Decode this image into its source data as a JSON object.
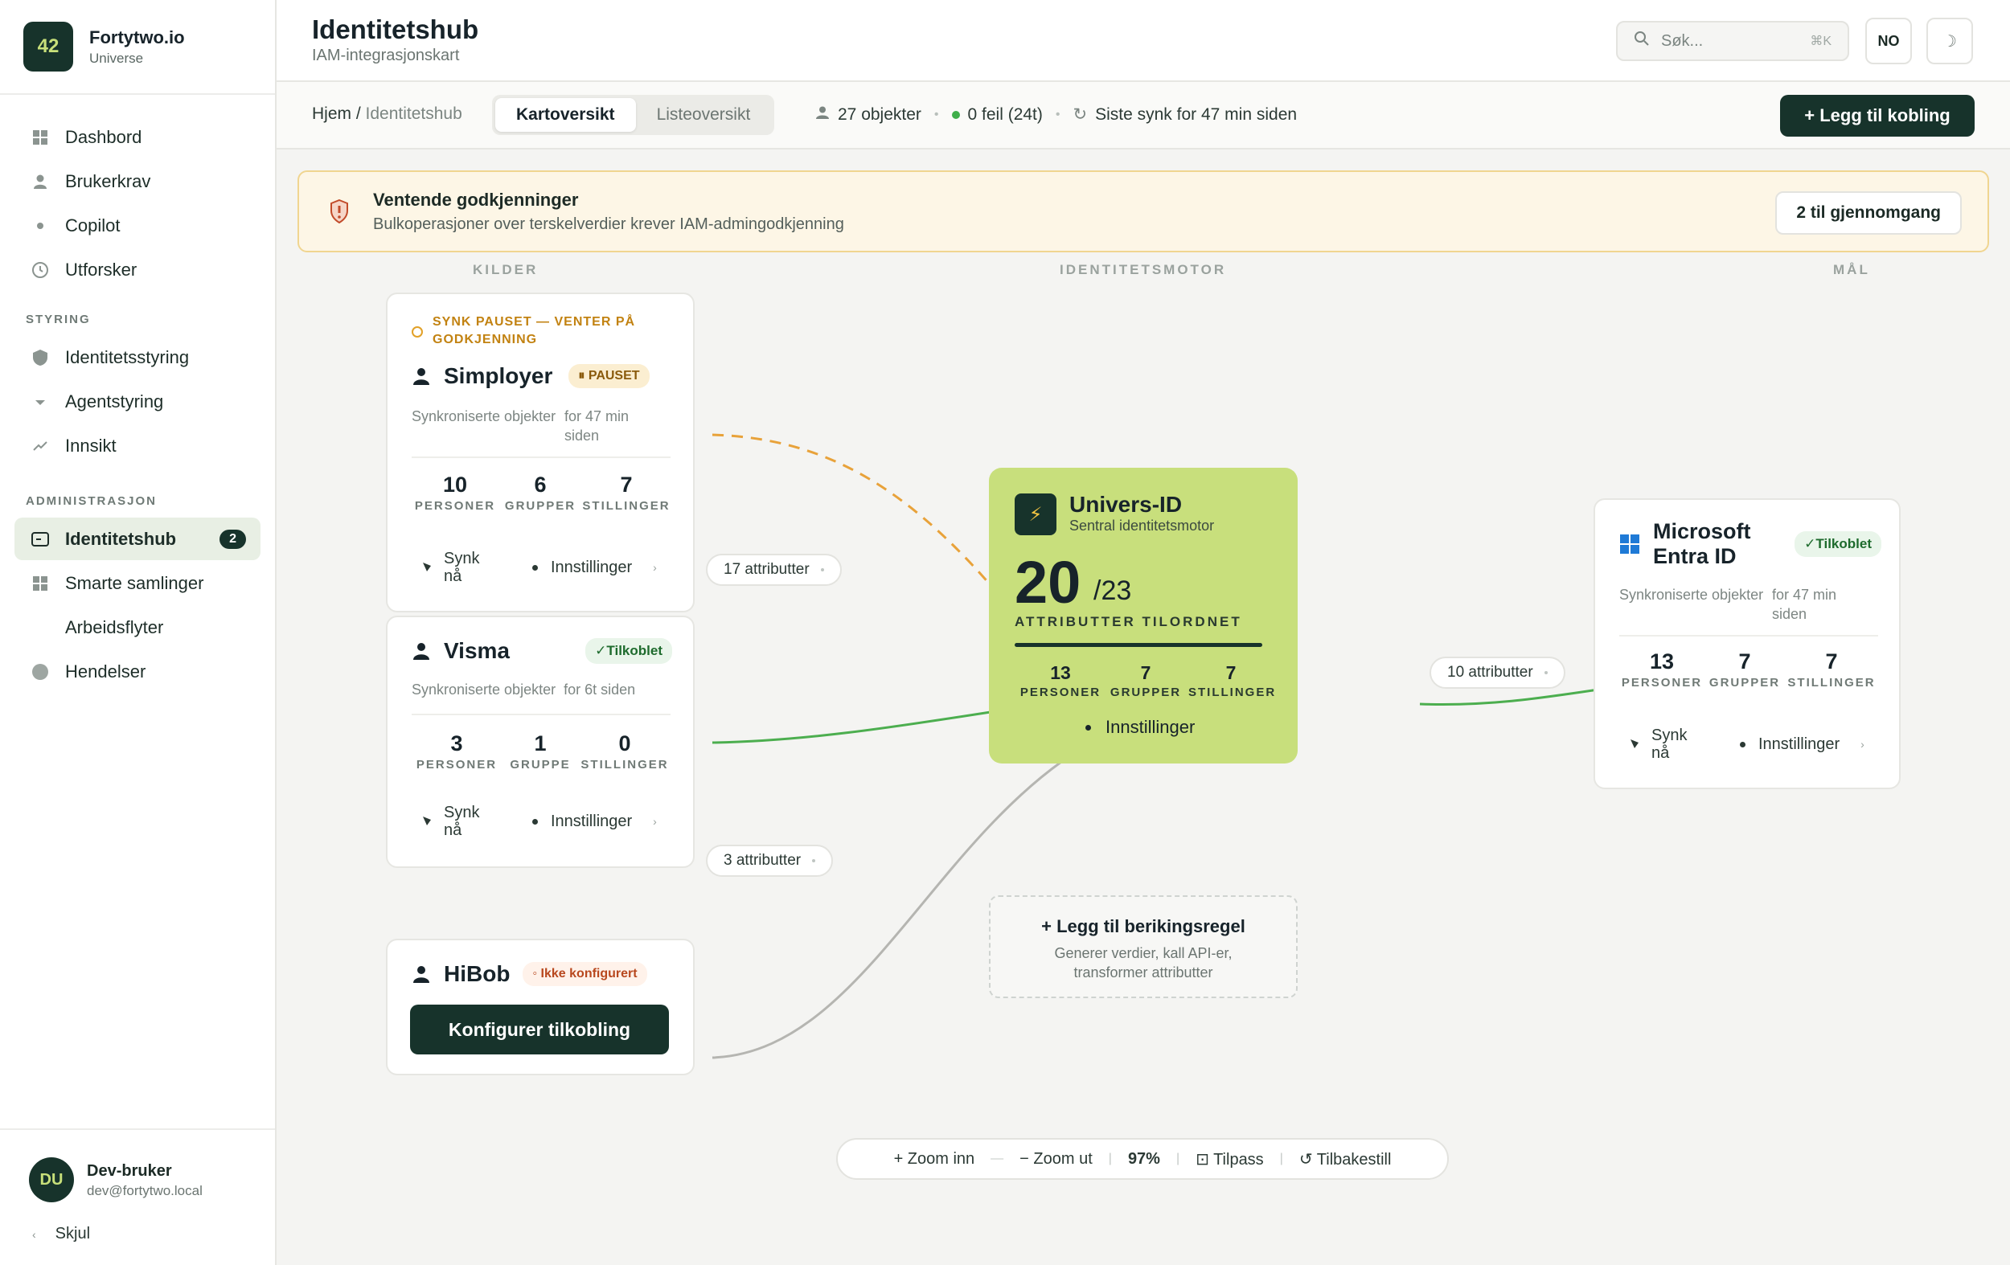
{
  "brand": {
    "logo": "42",
    "name": "Fortytwo.io",
    "sub": "Universe"
  },
  "nav": {
    "items": [
      {
        "label": "Dashbord",
        "icon": "grid-icon"
      },
      {
        "label": "Brukerkrav",
        "icon": "user-icon"
      },
      {
        "label": "Copilot",
        "icon": "dot-icon"
      },
      {
        "label": "Utforsker",
        "icon": "clock-icon"
      }
    ],
    "section_styring": "STYRING",
    "styring": [
      {
        "label": "Identitetsstyring",
        "icon": "shield-icon"
      },
      {
        "label": "Agentstyring",
        "icon": "dot-icon"
      },
      {
        "label": "Innsikt",
        "icon": "trend-icon"
      }
    ],
    "section_admin": "ADMINISTRASJON",
    "admin": [
      {
        "label": "Identitetshub",
        "icon": "hub-icon",
        "count": "2",
        "active": true
      },
      {
        "label": "Smarte samlinger",
        "icon": "grid-icon"
      },
      {
        "label": "Arbeidsflyter",
        "icon": ""
      },
      {
        "label": "Hendelser",
        "icon": "circle-icon"
      }
    ]
  },
  "user": {
    "initials": "DU",
    "name": "Dev-bruker",
    "email": "dev@fortytwo.local",
    "hide": "Skjul"
  },
  "header": {
    "title": "Identitetshub",
    "subtitle": "IAM-integrasjonskart",
    "search_placeholder": "Søk...",
    "search_kbd": "⌘K",
    "lang": "NO",
    "theme_icon": "☽"
  },
  "subbar": {
    "crumb_home": "Hjem",
    "crumb_sep": " / ",
    "crumb_current": "Identitetshub",
    "tabs": [
      "Kartoversikt",
      "Listeoversikt"
    ],
    "objects": "27 objekter",
    "errors": "0 feil (24t)",
    "last_sync": "Siste synk for 47 min siden",
    "add_button": "+  Legg til kobling"
  },
  "banner": {
    "title": "Ventende godkjenninger",
    "subtitle": "Bulkoperasjoner over terskelverdier krever IAM-admingodkjenning",
    "button": "2 til gjennomgang"
  },
  "columns": {
    "sources": "KILDER",
    "engine": "IDENTITETSMOTOR",
    "targets": "MÅL"
  },
  "sources": {
    "simployer": {
      "warning": "SYNK PAUSET — VENTER PÅ GODKJENNING",
      "name": "Simployer",
      "badge": "⏸ PAUSET",
      "meta_label": "Synkroniserte objekter",
      "meta_time": "for 47 min siden",
      "counts": [
        {
          "n": "10",
          "l": "PERSONER"
        },
        {
          "n": "6",
          "l": "GRUPPER"
        },
        {
          "n": "7",
          "l": "STILLINGER"
        }
      ],
      "sync": "Synk nå",
      "settings": "Innstillinger"
    },
    "visma": {
      "name": "Visma",
      "badge": "✓Tilkoblet",
      "meta_label": "Synkroniserte objekter",
      "meta_time": "for 6t siden",
      "counts": [
        {
          "n": "3",
          "l": "PERSONER"
        },
        {
          "n": "1",
          "l": "GRUPPE"
        },
        {
          "n": "0",
          "l": "STILLINGER"
        }
      ],
      "sync": "Synk nå",
      "settings": "Innstillinger"
    },
    "hibob": {
      "name": "HiBob",
      "badge": "◦ Ikke konfigurert",
      "cta": "Konfigurer tilkobling"
    }
  },
  "edges": {
    "simployer_attr": "17 attributter",
    "visma_attr": "3 attributter",
    "target_attr": "10 attributter"
  },
  "engine": {
    "title": "Univers-ID",
    "subtitle": "Sentral identitetsmotor",
    "mapped": "20",
    "total": "/23",
    "mapped_fraction": 0.87,
    "label": "ATTRIBUTTER TILORDNET",
    "counts": [
      {
        "n": "13",
        "l": "PERSONER"
      },
      {
        "n": "7",
        "l": "GRUPPER"
      },
      {
        "n": "7",
        "l": "STILLINGER"
      }
    ],
    "settings": "Innstillinger"
  },
  "enrich": {
    "title": "+ Legg til berikingsregel",
    "subtitle_1": "Generer verdier, kall API-er,",
    "subtitle_2": "transformer attributter"
  },
  "target": {
    "name_1": "Microsoft",
    "name_2": "Entra ID",
    "badge": "✓Tilkoblet",
    "meta_label": "Synkroniserte objekter",
    "meta_time": "for 47 min siden",
    "counts": [
      {
        "n": "13",
        "l": "PERSONER"
      },
      {
        "n": "7",
        "l": "GRUPPER"
      },
      {
        "n": "7",
        "l": "STILLINGER"
      }
    ],
    "sync": "Synk nå",
    "settings": "Innstillinger"
  },
  "zoom": {
    "zoom_in": "+ Zoom inn",
    "zoom_out": "− Zoom ut",
    "level": "97%",
    "fit": "⊡ Tilpass",
    "reset": "↺ Tilbakestill"
  },
  "colors": {
    "accent": "#17332b",
    "engine": "#c8df7c",
    "warning": "#e8a23a",
    "ok": "#4cae4f",
    "edge_grey": "#b5b5b1"
  }
}
